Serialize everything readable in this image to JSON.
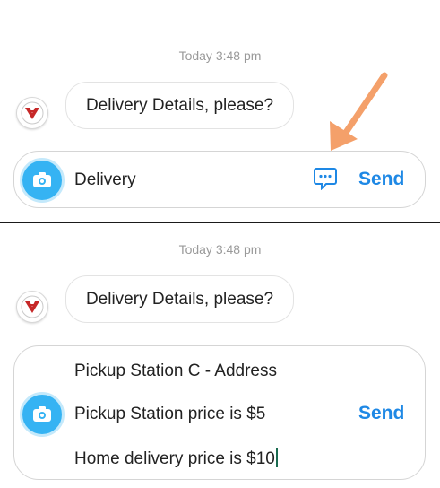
{
  "colors": {
    "accent_blue": "#1e88e5",
    "camera_blue": "#35b3f3",
    "annotation_orange": "#f4a06a"
  },
  "top_panel": {
    "timestamp": "Today 3:48 pm",
    "message": "Delivery Details, please?",
    "input_value": "Delivery",
    "quick_reply_icon": "chat-bubble-dots-icon",
    "send_label": "Send",
    "annotation": "arrow-pointing-to-quick-replies"
  },
  "bottom_panel": {
    "timestamp": "Today 3:48 pm",
    "message": "Delivery Details, please?",
    "input_lines": [
      "Pickup Station C - Address",
      "Pickup Station price is $5",
      "Home delivery price is $10"
    ],
    "send_label": "Send"
  }
}
